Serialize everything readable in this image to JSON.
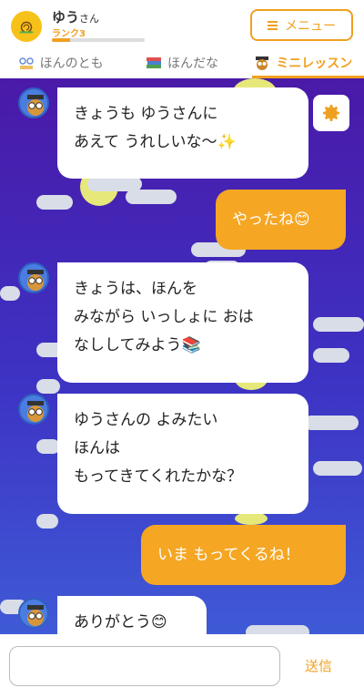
{
  "header": {
    "user_name": "ゆう",
    "user_suffix": "さん",
    "rank_label": "ランク3",
    "rank_progress": 0.2,
    "menu_label": "メニュー"
  },
  "tabs": [
    {
      "label": "ほんのとも",
      "icon": "glasses-book-icon",
      "active": false
    },
    {
      "label": "ほんだな",
      "icon": "books-stack-icon",
      "active": false
    },
    {
      "label": "ミニレッスン",
      "icon": "owl-icon",
      "active": true
    }
  ],
  "messages": [
    {
      "from": "bot",
      "lines": [
        "きょうも ゆうさんに",
        "あえて うれしいな〜✨"
      ]
    },
    {
      "from": "user",
      "text": "やったね😊"
    },
    {
      "from": "bot",
      "lines": [
        "きょうは、ほんを",
        "みながら いっしょに おは",
        "なししてみよう📚"
      ]
    },
    {
      "from": "bot",
      "lines": [
        "ゆうさんの よみたい",
        "ほんは",
        "もってきてくれたかな？"
      ]
    },
    {
      "from": "user",
      "text": "いま もってくるね！"
    },
    {
      "from": "bot",
      "lines": [
        "ありがとう😊"
      ]
    }
  ],
  "input": {
    "placeholder": "",
    "value": "",
    "send_label": "送信"
  },
  "colors": {
    "accent": "#f0a020",
    "user_bubble": "#f5a623",
    "bg_top": "#4a19a8",
    "bg_bottom": "#3f5ad6"
  }
}
